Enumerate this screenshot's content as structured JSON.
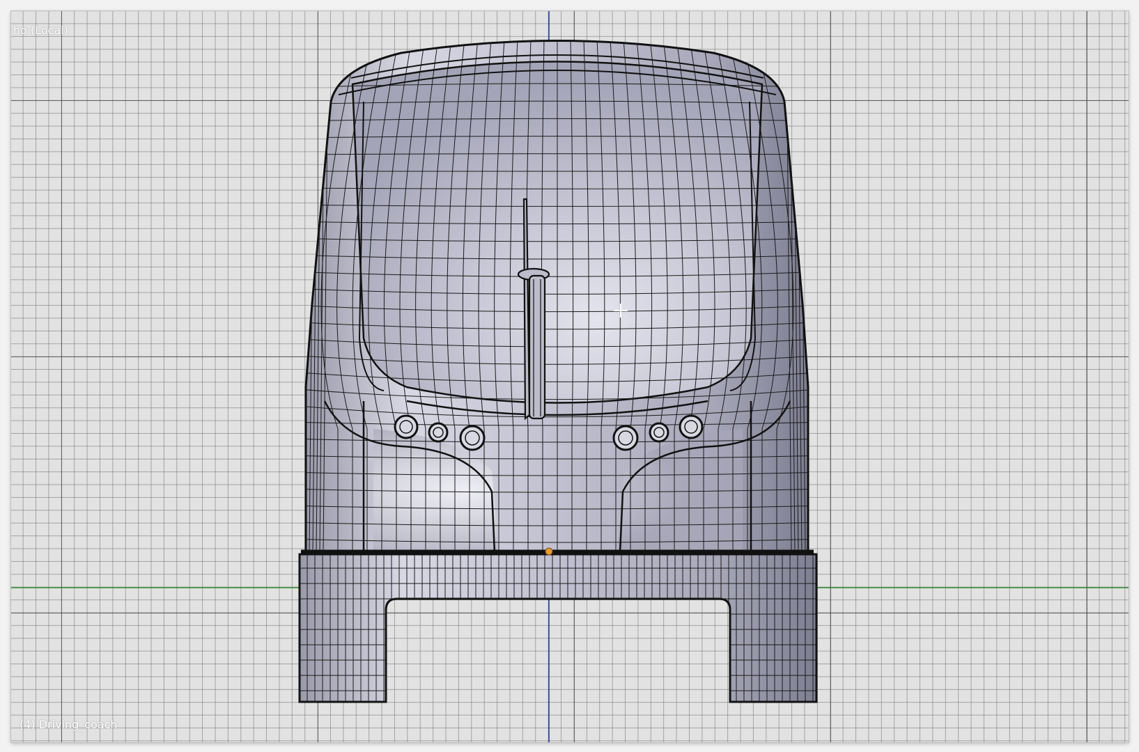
{
  "viewport": {
    "view_label": "ho (Local)",
    "object_label": "(4) Driving_coach",
    "grid_minor_color": "#6e6e6e",
    "grid_major_color": "#464646",
    "background_color": "#e2e2e2",
    "x_axis_color": "#2e8b2e",
    "z_axis_color": "#2a3fa8",
    "mesh_fill_color": "#b8b8c8",
    "wire_color": "#111111",
    "origin_color": "#e89a2a"
  }
}
